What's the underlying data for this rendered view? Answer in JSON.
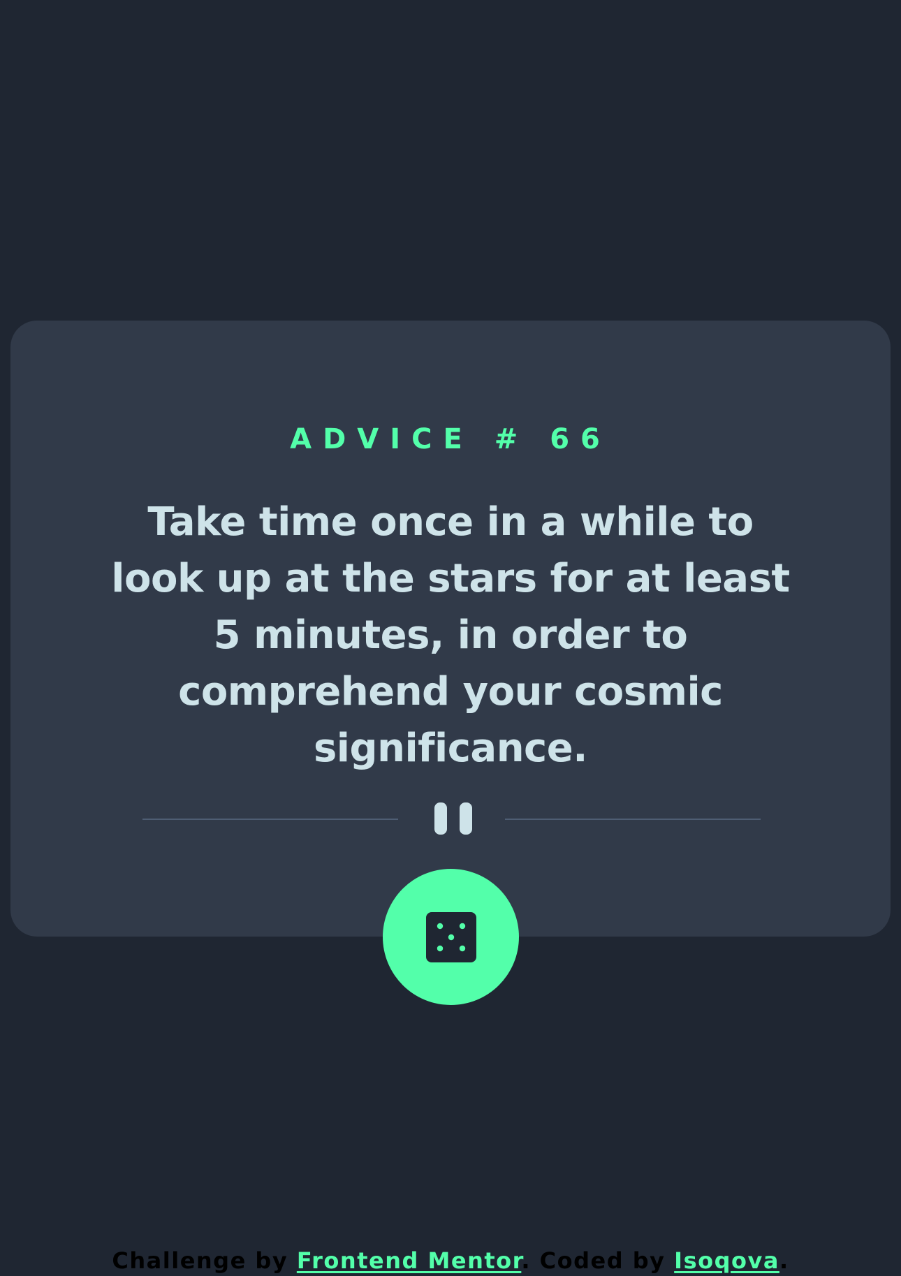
{
  "advice": {
    "label": "ADVICE # 66",
    "text": "Take time once in a while to look up at the stars for at least 5 minutes, in order to comprehend your cosmic significance."
  },
  "controls": {
    "dice_icon": "dice-five-icon",
    "divider_icon": "pause-icon"
  },
  "footer": {
    "prefix": "Challenge by ",
    "challenge_link": "Frontend Mentor",
    "middle": ". Coded by ",
    "author_link": "Isoqova",
    "suffix": "."
  },
  "colors": {
    "background": "#1f2632",
    "card": "#313a49",
    "accent": "#53ffaa",
    "text": "#cee3e9",
    "divider": "#4e5d73"
  }
}
